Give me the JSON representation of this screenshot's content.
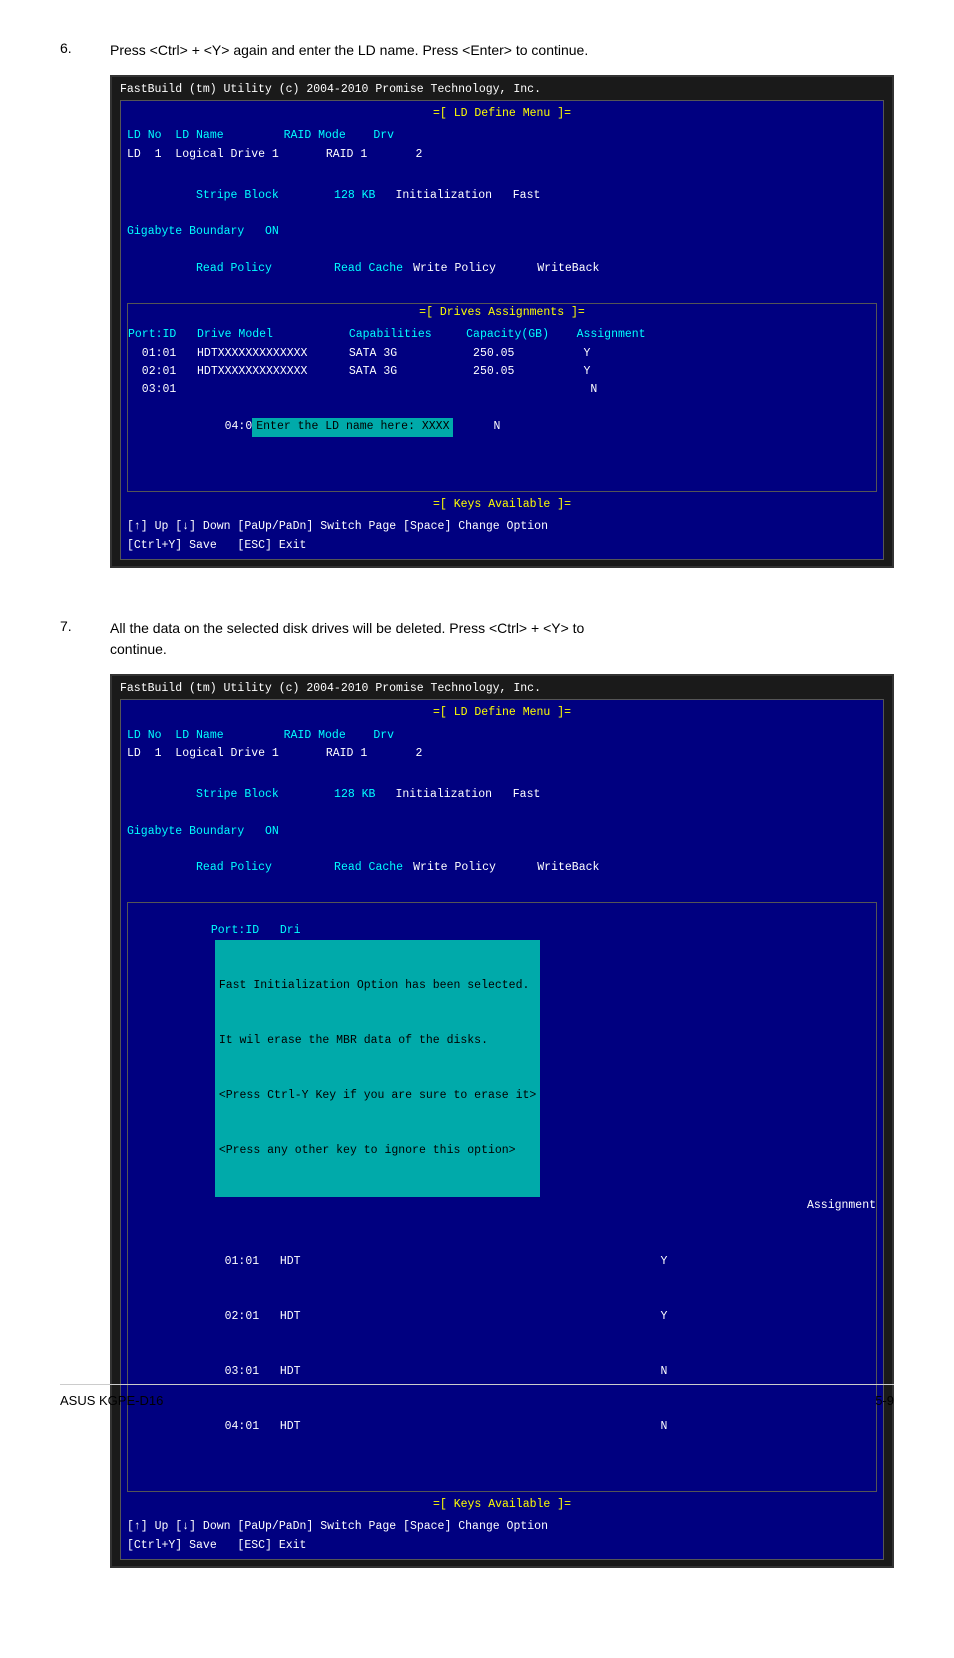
{
  "page": {
    "footer_left": "ASUS KGPE-D16",
    "footer_right": "5-9"
  },
  "step6": {
    "number": "6.",
    "text": "Press <Ctrl> + <Y> again and enter the LD name. Press <Enter> to continue.",
    "terminal": {
      "title": "FastBuild (tm) Utility (c) 2004-2010 Promise Technology, Inc.",
      "ld_menu_header": "=[ LD Define Menu ]=",
      "row1_label": "LD No  LD Name",
      "row1_right": "RAID Mode    Drv",
      "row2_label": "LD  1  Logical Drive 1",
      "row2_right": "RAID 1       2",
      "row3_label": "Stripe Block        128 KB",
      "row3_right": "Initialization   Fast",
      "row4_label": "Gigabyte Boundary   ON",
      "row5_label": "Read Policy         Read Cache",
      "row5_right": "Write Policy      WriteBack",
      "drives_header": "=[ Drives Assignments ]=",
      "drives_col": "Port:ID   Drive Model           Capabilities     Capacity(GB)    Assignment",
      "drive1": "  01:01   HDTXXXXXXXXXXXXX      SATA 3G           250.05          Y",
      "drive2": "  02:01   HDTXXXXXXXXXXXXX      SATA 3G           250.05          Y",
      "drive3": "  03:01                                                            N",
      "drive4_prefix": "  04:0",
      "input_label": "Enter the LD name here: XXXX",
      "drive4_suffix": "N",
      "keys_header": "=[ Keys Available ]=",
      "keys1": "[↑] Up [↓] Down [PaUp/PaDn] Switch Page [Space] Change Option",
      "keys2": "[Ctrl+Y] Save   [ESC] Exit"
    }
  },
  "step7": {
    "number": "7.",
    "text1": "All the data on the selected disk drives will be deleted. Press <Ctrl> + <Y> to",
    "text2": "continue.",
    "terminal": {
      "title": "FastBuild (tm) Utility (c) 2004-2010 Promise Technology, Inc.",
      "ld_menu_header": "=[ LD Define Menu ]=",
      "row1_label": "LD No  LD Name",
      "row1_right": "RAID Mode    Drv",
      "row2_label": "LD  1  Logical Drive 1",
      "row2_right": "RAID 1       2",
      "row3_label": "Stripe Block        128 KB",
      "row3_right": "Initialization   Fast",
      "row4_label": "Gigabyte Boundary   ON",
      "row5_label": "Read Policy         Read Cache",
      "row5_right": "Write Policy      WriteBack",
      "drives_col": "Port:ID   Dri",
      "drive1": "  01:01   HDT",
      "drive2": "  02:01   HDT",
      "drive3": "  03:01   HDT",
      "drive4": "  04:01   HDT",
      "popup_line1": "Fast Initialization Option has been selected.",
      "popup_line2": "It wil erase the MBR data of the disks.",
      "popup_line3": "<Press Ctrl-Y Key if you are sure to erase it>",
      "popup_line4": "<Press any other key to ignore this option>",
      "assign1": "Assignment",
      "assign2": "Y",
      "assign3": "Y",
      "assign4": "N",
      "assign5": "N",
      "keys_header": "=[ Keys Available ]=",
      "keys1": "[↑] Up [↓] Down [PaUp/PaDn] Switch Page [Space] Change Option",
      "keys2": "[Ctrl+Y] Save   [ESC] Exit"
    }
  }
}
